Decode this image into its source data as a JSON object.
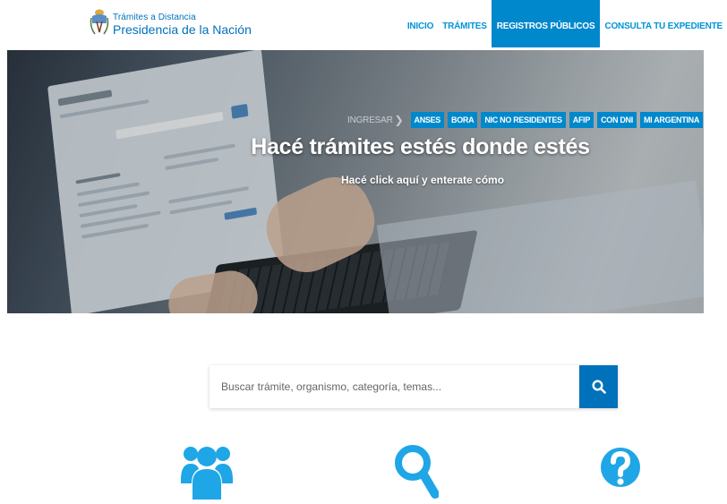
{
  "header": {
    "logo_line1": "Trámites a Distancia",
    "logo_line2": "Presidencia de la Nación",
    "nav": [
      {
        "label": "INICIO",
        "active": false
      },
      {
        "label": "TRÁMITES",
        "active": false
      },
      {
        "label": "REGISTROS PÚBLICOS",
        "active": true
      },
      {
        "label": "CONSULTA TU EXPEDIENTE",
        "active": false
      }
    ]
  },
  "hero": {
    "title": "Hacé trámites estés donde estés",
    "subtitle": "Hacé click aquí y enterate cómo",
    "ingresar_label": "INGRESAR",
    "quicklinks": [
      "ANSES",
      "BORA",
      "NIC NO RESIDENTES",
      "AFIP",
      "CON DNI",
      "MI ARGENTINA"
    ],
    "slides": 2,
    "active_slide": 2
  },
  "search": {
    "placeholder": "Buscar trámite, organismo, categoría, temas...",
    "value": ""
  },
  "features": [
    {
      "icon": "users-icon"
    },
    {
      "icon": "search-icon"
    },
    {
      "icon": "question-icon"
    }
  ],
  "colors": {
    "brand": "#0072bb",
    "nav_text": "#0095d5",
    "nav_active_bg": "#0088cc",
    "feature_icon": "#1fa6e6"
  }
}
